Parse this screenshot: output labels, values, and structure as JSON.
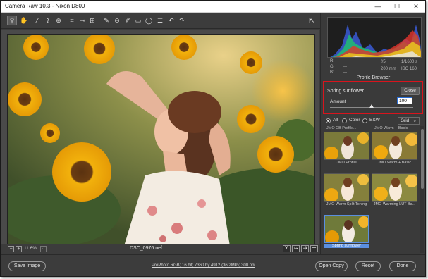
{
  "window": {
    "title": "Camera Raw 10.3  -  Nikon D800",
    "controls": [
      "—",
      "☐",
      "✕"
    ]
  },
  "toolbar": {
    "tools": [
      "zoom-icon",
      "hand-icon",
      "white-balance-icon",
      "color-sampler-icon",
      "targeted-adjustment-icon",
      "crop-icon",
      "straighten-icon",
      "transform-icon",
      "spot-removal-icon",
      "red-eye-icon",
      "adjustment-brush-icon",
      "graduated-filter-icon",
      "radial-filter-icon",
      "preferences-icon",
      "rotate-left-icon",
      "rotate-right-icon"
    ]
  },
  "image": {
    "zoom": "11.6%",
    "filename": "DSC_0976.nef"
  },
  "histogram": {
    "r_label": "R:",
    "g_label": "G:",
    "b_label": "B:",
    "r_value": "---",
    "g_value": "---",
    "b_value": "---",
    "aperture": "f/5",
    "shutter": "1/1600 s",
    "iso": "ISO 160",
    "focal": "200 mm"
  },
  "profile_browser": {
    "title": "Profile Browser",
    "selected_profile": "Spring sunflower",
    "close_label": "Close",
    "amount_label": "Amount",
    "amount_value": "100",
    "amount_fraction": 0.5,
    "filters": [
      {
        "label": "All",
        "selected": true
      },
      {
        "label": "Color",
        "selected": false
      },
      {
        "label": "B&W",
        "selected": false
      }
    ],
    "view_mode": "Grid",
    "cut_labels": [
      "JMO CB Profile...",
      "JMO Warm + Basic"
    ],
    "profiles": [
      {
        "label": "JMO Profile",
        "selected": false
      },
      {
        "label": "JMO Warm + Basic",
        "selected": false
      },
      {
        "label": "JMO Warm Split Toning",
        "selected": false
      },
      {
        "label": "JMO Warming LUT Ba...",
        "selected": false
      },
      {
        "label": "Spring sunflower",
        "selected": true
      }
    ]
  },
  "bottom": {
    "save_label": "Save Image",
    "workflow_link": "ProPhoto RGB; 16 bit; 7360 by 4912 (36.2MP); 300 ppi",
    "open_label": "Open Copy",
    "reset_label": "Reset",
    "done_label": "Done"
  },
  "colors": {
    "accent_red": "#d8141d",
    "selection_blue": "#5a8fe0",
    "panel_bg": "#3a3a3a"
  }
}
